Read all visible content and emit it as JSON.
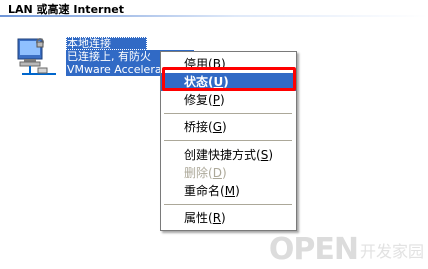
{
  "header": {
    "title": "LAN 或高速 Internet"
  },
  "connection": {
    "name": "本地连接",
    "status": "已连接上, 有防火",
    "device": "VMware Accelerat"
  },
  "context_menu": {
    "items": [
      {
        "label": "停用",
        "key": "B",
        "state": "normal"
      },
      {
        "label": "状态",
        "key": "U",
        "state": "selected"
      },
      {
        "label": "修复",
        "key": "P",
        "state": "normal"
      },
      {
        "label": "桥接",
        "key": "G",
        "state": "normal"
      },
      {
        "label": "创建快捷方式",
        "key": "S",
        "state": "normal"
      },
      {
        "label": "删除",
        "key": "D",
        "state": "disabled"
      },
      {
        "label": "重命名",
        "key": "M",
        "state": "normal"
      },
      {
        "label": "属性",
        "key": "R",
        "state": "normal"
      }
    ]
  },
  "colors": {
    "selection": "#316ac5",
    "highlight_box": "#ff0000",
    "disabled_text": "#aca899"
  },
  "watermark": {
    "logo": "OPEN",
    "subtitle": "开发家园"
  }
}
